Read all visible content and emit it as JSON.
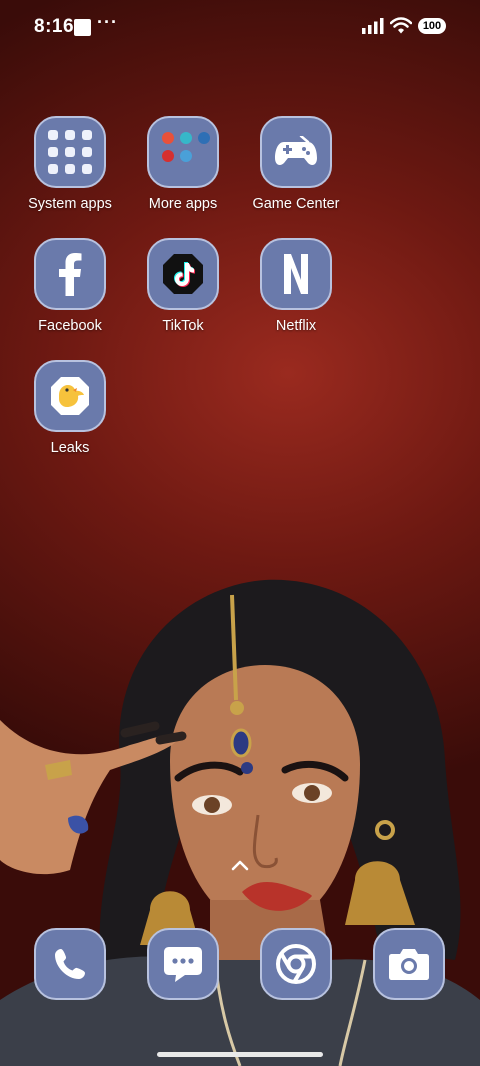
{
  "status_bar": {
    "time": "8:16",
    "notification_dots": "···",
    "battery": "100"
  },
  "apps": [
    {
      "label": "System apps",
      "icon": "system-apps-folder-icon"
    },
    {
      "label": "More apps",
      "icon": "more-apps-folder-icon"
    },
    {
      "label": "Game Center",
      "icon": "game-controller-icon"
    },
    {
      "label": "Facebook",
      "icon": "facebook-icon"
    },
    {
      "label": "TikTok",
      "icon": "tiktok-icon"
    },
    {
      "label": "Netflix",
      "icon": "netflix-icon"
    },
    {
      "label": "Leaks",
      "icon": "leaks-bird-icon"
    }
  ],
  "dock": [
    {
      "icon": "phone-icon"
    },
    {
      "icon": "messages-icon"
    },
    {
      "icon": "chrome-icon"
    },
    {
      "icon": "camera-icon"
    }
  ],
  "colors": {
    "icon_background": "#6a7aab",
    "icon_border": "#b8c2df",
    "wallpaper": "#6e1912"
  }
}
